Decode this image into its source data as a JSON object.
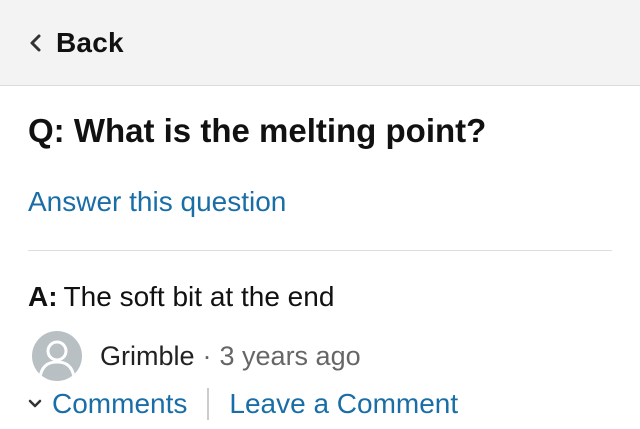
{
  "header": {
    "back_label": "Back"
  },
  "question": {
    "text": "Q: What is the melting point?"
  },
  "answer_link": "Answer this question",
  "answer": {
    "prefix": "A:",
    "text": "The soft bit at the end",
    "author": "Grimble",
    "separator": "·",
    "timestamp": "3 years ago"
  },
  "actions": {
    "comments_label": "Comments",
    "leave_comment_label": "Leave a Comment"
  },
  "colors": {
    "link": "#1a6ea7",
    "header_bg": "#f3f3f3",
    "avatar_bg": "#b9c0c4"
  },
  "icons": {
    "back": "chevron-left-icon",
    "avatar": "user-avatar-icon",
    "expand": "chevron-down-icon"
  }
}
